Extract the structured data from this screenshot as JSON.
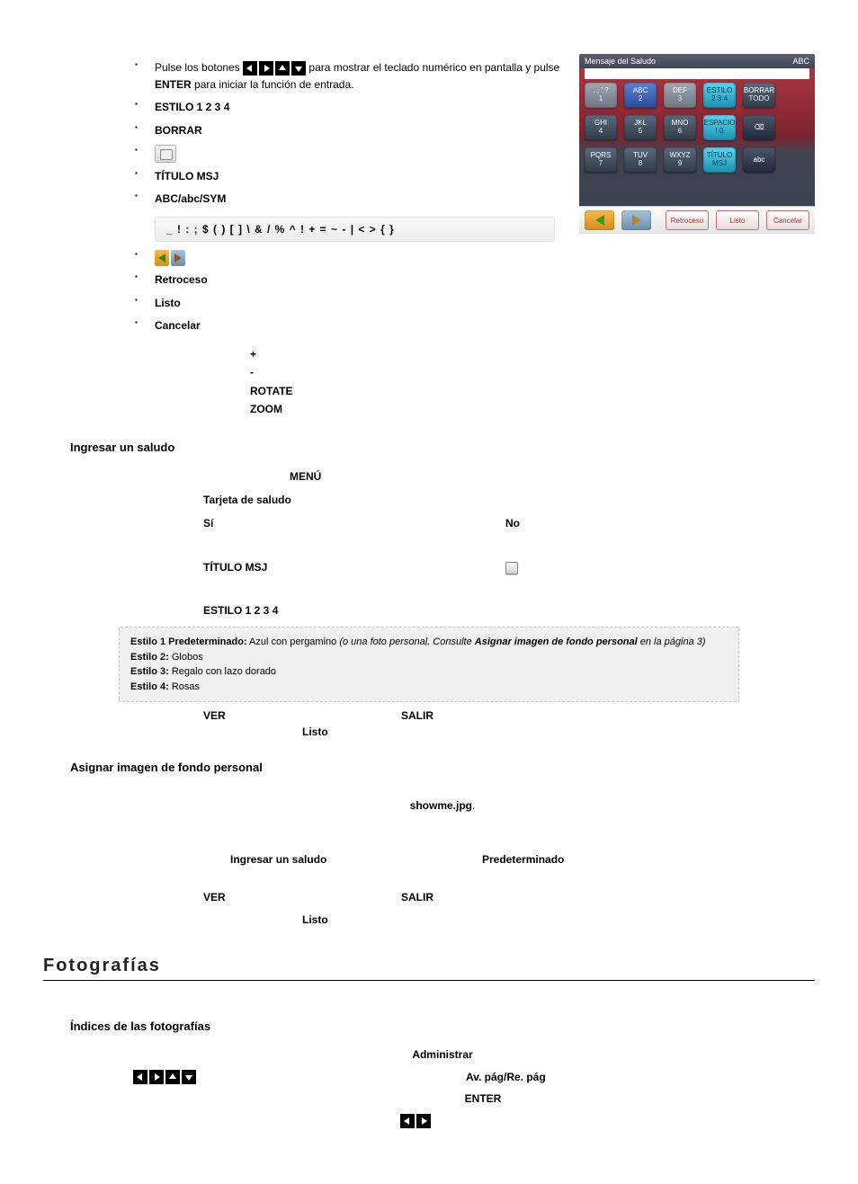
{
  "osd": {
    "header_left": "Mensaje del Saludo",
    "header_right": "ABC",
    "rows": [
      [
        {
          "top": ". , ' ?",
          "num": "1",
          "cls": "k-gray"
        },
        {
          "top": "ABC",
          "num": "2",
          "cls": "k-bl"
        },
        {
          "top": "DEF",
          "num": "3",
          "cls": "k-gray"
        },
        {
          "top": "ESTILO",
          "num": "2 3 4",
          "cls": "k-cyan"
        },
        {
          "top": "BORRAR",
          "num": "TODO",
          "cls": "k-dark"
        }
      ],
      [
        {
          "top": "GHI",
          "num": "4",
          "cls": "k-dark"
        },
        {
          "top": "JKL",
          "num": "5",
          "cls": "k-dark"
        },
        {
          "top": "MNO",
          "num": "6",
          "cls": "k-dark"
        },
        {
          "top": "ESPACIO",
          "num": "! 0",
          "cls": "k-cyan"
        },
        {
          "top": "⌫",
          "num": "",
          "cls": "k-dk"
        }
      ],
      [
        {
          "top": "PQRS",
          "num": "7",
          "cls": "k-dark"
        },
        {
          "top": "TUV",
          "num": "8",
          "cls": "k-dark"
        },
        {
          "top": "WXYZ",
          "num": "9",
          "cls": "k-dark"
        },
        {
          "top": "TÍTULO",
          "num": "MSJ",
          "cls": "k-cyan"
        },
        {
          "top": "abc",
          "num": "",
          "cls": "k-dk"
        }
      ]
    ],
    "footer": {
      "retroceso": "Retroceso",
      "listo": "Listo",
      "cancelar": "Cancelar"
    }
  },
  "ul1": {
    "prefix_text": "Pulse los botones ",
    "enter_text": "ENTER",
    "suffix_text": " para mostrar el teclado numérico en pantalla y pulse ",
    "suffix_text2": " para iniciar la función de entrada.",
    "estilo": "ESTILO 1 2 3 4",
    "borrar": "BORRAR",
    "titulo_msj": "TÍTULO MSJ",
    "abc": "ABC/abc/SYM",
    "sym_chars": "_ ! : ; $ ( ) [ ] \\ & / % ^ ! + = ~ - | < > { }",
    "retroceso": "Retroceso",
    "listo": "Listo",
    "cancelar": "Cancelar"
  },
  "indent1": {
    "plus": "+",
    "minus": "-",
    "rotate": "ROTATE",
    "zoom": "ZOOM"
  },
  "sec1": {
    "h": "Ingresar un saludo",
    "menu": "MENÚ",
    "tarjeta": "Tarjeta de saludo",
    "si": "Sí",
    "no": "No",
    "titulo_msj": "TÍTULO MSJ",
    "estilo": "ESTILO 1 2 3 4",
    "ver": "VER",
    "salir": "SALIR",
    "listo": "Listo"
  },
  "grey": {
    "s1a": "Estilo 1 Predeterminado:",
    "s1b": " Azul con pergamino ",
    "s1c": "(o una foto personal. Consulte ",
    "s1d": "Asignar imagen de fondo personal",
    "s1e": " en la página 3)",
    "s2a": "Estilo 2:",
    "s2b": " Globos",
    "s3a": "Estilo 3:",
    "s3b": " Regalo con lazo dorado",
    "s4a": "Estilo 4:",
    "s4b": " Rosas"
  },
  "sec2": {
    "h": "Asignar imagen de fondo personal",
    "file": "showme.jpg",
    "ingresar": "Ingresar un saludo",
    "pred": "Predeterminado",
    "ver": "VER",
    "salir": "SALIR",
    "listo": "Listo"
  },
  "photos": {
    "title": "Fotografías",
    "sub": "Índices de las fotografías",
    "admin": "Administrar",
    "avre": "Av. pág/Re. pág",
    "enter": "ENTER"
  }
}
